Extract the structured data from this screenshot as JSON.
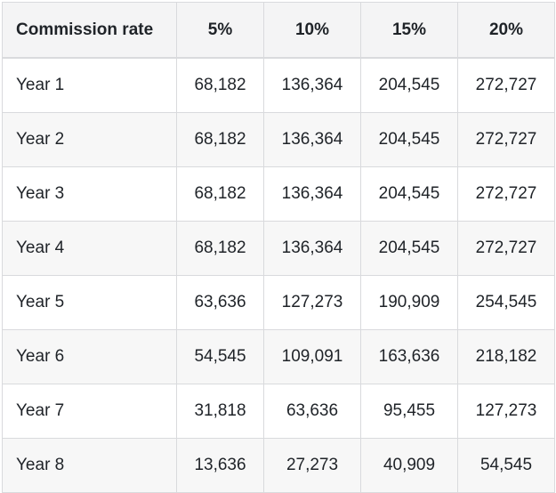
{
  "table": {
    "headers": [
      "Commission rate",
      "5%",
      "10%",
      "15%",
      "20%"
    ],
    "rows": [
      {
        "label": "Year 1",
        "values": [
          "68,182",
          "136,364",
          "204,545",
          "272,727"
        ]
      },
      {
        "label": "Year 2",
        "values": [
          "68,182",
          "136,364",
          "204,545",
          "272,727"
        ]
      },
      {
        "label": "Year 3",
        "values": [
          "68,182",
          "136,364",
          "204,545",
          "272,727"
        ]
      },
      {
        "label": "Year 4",
        "values": [
          "68,182",
          "136,364",
          "204,545",
          "272,727"
        ]
      },
      {
        "label": "Year 5",
        "values": [
          "63,636",
          "127,273",
          "190,909",
          "254,545"
        ]
      },
      {
        "label": "Year 6",
        "values": [
          "54,545",
          "109,091",
          "163,636",
          "218,182"
        ]
      },
      {
        "label": "Year 7",
        "values": [
          "31,818",
          "63,636",
          "95,455",
          "127,273"
        ]
      },
      {
        "label": "Year 8",
        "values": [
          "13,636",
          "27,273",
          "40,909",
          "54,545"
        ]
      }
    ]
  },
  "colors": {
    "header_bg": "#f4f4f5",
    "row_alt_bg": "#f7f7f7",
    "border": "#d9dadd",
    "text": "#1f2328"
  }
}
